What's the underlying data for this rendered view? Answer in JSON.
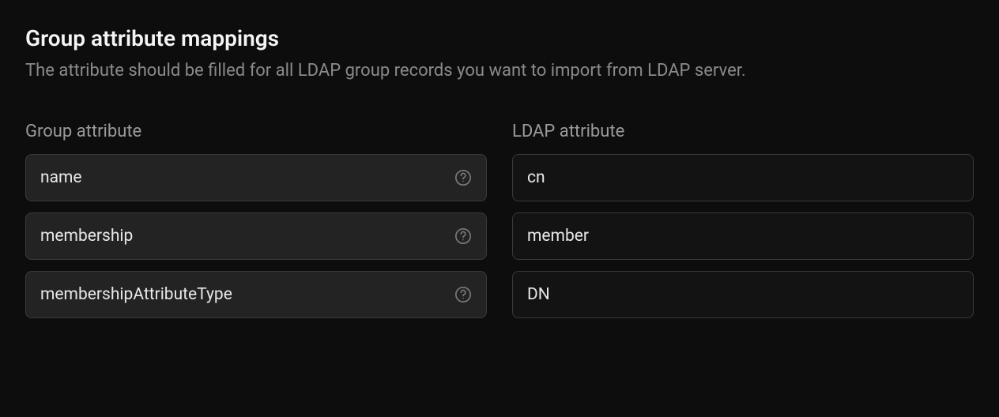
{
  "section": {
    "title": "Group attribute mappings",
    "description": "The attribute should be filled for all LDAP group records you want to import from LDAP server."
  },
  "columns": {
    "group_attribute_header": "Group attribute",
    "ldap_attribute_header": "LDAP attribute"
  },
  "mappings": [
    {
      "group_attribute": "name",
      "ldap_attribute": "cn"
    },
    {
      "group_attribute": "membership",
      "ldap_attribute": "member"
    },
    {
      "group_attribute": "membershipAttributeType",
      "ldap_attribute": "DN"
    }
  ]
}
